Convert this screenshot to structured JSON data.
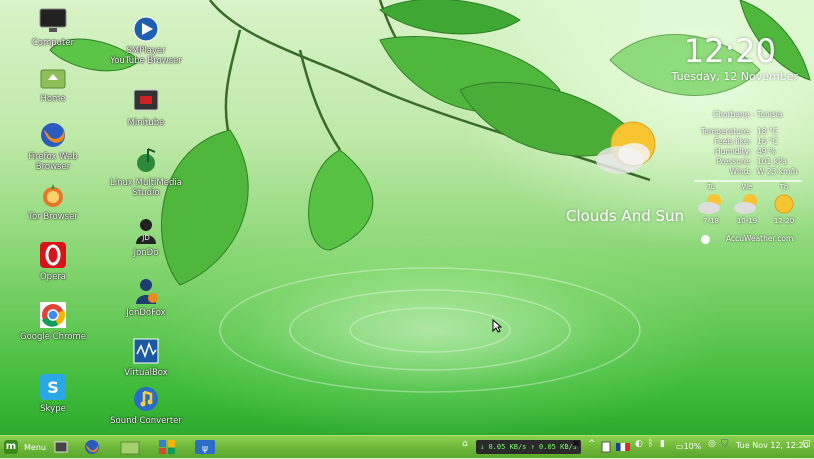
{
  "desktop_icons": [
    {
      "id": "computer",
      "label": "Computer",
      "icon": "monitor-icon"
    },
    {
      "id": "home",
      "label": "Home",
      "icon": "home-folder-icon"
    },
    {
      "id": "firefox",
      "label": "Firefox Web\nBrowser",
      "icon": "firefox-icon"
    },
    {
      "id": "tor",
      "label": "Tor Browser",
      "icon": "tor-onion-icon"
    },
    {
      "id": "opera",
      "label": "Opera",
      "icon": "opera-icon"
    },
    {
      "id": "chrome",
      "label": "Google Chrome",
      "icon": "chrome-icon"
    },
    {
      "id": "skype",
      "label": "Skype",
      "icon": "skype-icon"
    },
    {
      "id": "smplayer",
      "label": "SMPlayer\nYouTube Browser",
      "icon": "smplayer-icon"
    },
    {
      "id": "minitube",
      "label": "Minitube",
      "icon": "minitube-icon"
    },
    {
      "id": "lmms",
      "label": "Linux MultiMedia\nStudio",
      "icon": "lmms-icon"
    },
    {
      "id": "jondo",
      "label": "JonDo",
      "icon": "jondo-icon"
    },
    {
      "id": "jondofox",
      "label": "JonDoFox",
      "icon": "jondofox-icon"
    },
    {
      "id": "virtualbox",
      "label": "VirtualBox",
      "icon": "virtualbox-icon"
    },
    {
      "id": "soundconverter",
      "label": "Sound Converter",
      "icon": "sound-converter-icon"
    }
  ],
  "clock": {
    "time": "12:20",
    "date": "Tuesday, 12 November"
  },
  "weather": {
    "location": "Chorbane - Tunisia",
    "condition": "Clouds And Sun",
    "details": [
      {
        "k": "Temperature:",
        "v": "18 °C"
      },
      {
        "k": "Feels like:",
        "v": "16 °C"
      },
      {
        "k": "Humidity:",
        "v": "49 %"
      },
      {
        "k": "Pressure:",
        "v": "101 kPa"
      },
      {
        "k": "Wind:",
        "v": "W 23 km/h"
      }
    ],
    "forecast": [
      {
        "day": "Tu",
        "range": "7-18",
        "icon": "cloud-sun-icon"
      },
      {
        "day": "We",
        "range": "10-19",
        "icon": "cloud-sun-icon"
      },
      {
        "day": "Th",
        "range": "12-20",
        "icon": "sun-icon"
      }
    ],
    "source": "AccuWeather.com"
  },
  "taskbar": {
    "menu_label": "Menu",
    "net_down": "0.05 KB/s",
    "net_up": "0.05 KB/s",
    "battery": "10%",
    "datetime": "Tue Nov 12, 12:20"
  },
  "colors": {
    "taskbar": "#6fb83a",
    "accent": "#23a227"
  }
}
